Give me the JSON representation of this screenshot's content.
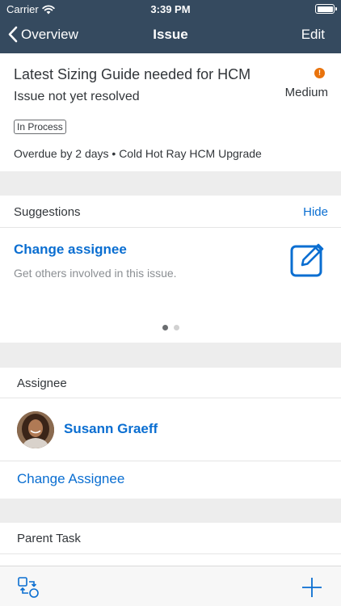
{
  "status_bar": {
    "carrier": "Carrier",
    "time": "3:39 PM"
  },
  "nav": {
    "back_label": "Overview",
    "title": "Issue",
    "edit_label": "Edit"
  },
  "issue": {
    "title": "Latest Sizing Guide needed for HCM",
    "subtitle": "Issue not yet resolved",
    "priority_glyph": "!",
    "priority": "Medium",
    "priority_color": "#e9730c",
    "status": "In Process",
    "meta": "Overdue by 2 days • Cold Hot Ray HCM Upgrade"
  },
  "suggestions": {
    "heading": "Suggestions",
    "hide_label": "Hide",
    "card_title": "Change assignee",
    "card_description": "Get others involved in this issue.",
    "icon": "edit-icon",
    "page_count": 2,
    "active_page": 1
  },
  "assignee": {
    "heading": "Assignee",
    "name": "Susann Graeff",
    "change_label": "Change Assignee"
  },
  "parent_task": {
    "heading": "Parent Task"
  },
  "toolbar": {
    "left_icon": "workflow-icon",
    "right_icon": "add-icon"
  },
  "colors": {
    "nav": "#354a5f",
    "accent": "#0a6ed1",
    "warning": "#e9730c"
  }
}
